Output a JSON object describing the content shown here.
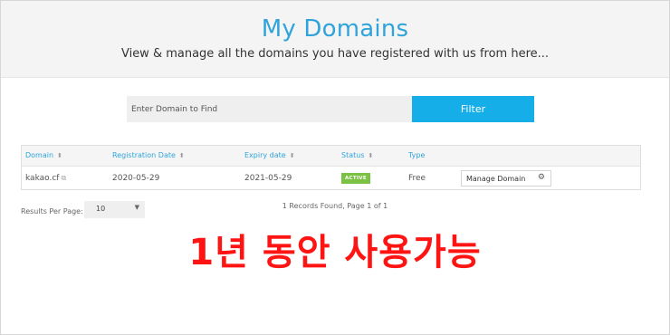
{
  "header": {
    "title": "My Domains",
    "subtitle": "View & manage all the domains you have registered with us from here..."
  },
  "search": {
    "placeholder": "Enter Domain to Find",
    "button_label": "Filter"
  },
  "table": {
    "columns": [
      "Domain",
      "Registration Date",
      "Expiry date",
      "Status",
      "Type"
    ],
    "rows": [
      {
        "domain": "kakao.cf",
        "registration_date": "2020-05-29",
        "expiry_date": "2021-05-29",
        "status": "ACTIVE",
        "type": "Free",
        "action_label": "Manage Domain"
      }
    ]
  },
  "pagination": {
    "results_per_page_label": "Results Per Page:",
    "results_per_page_value": "10",
    "records_text": "1 Records Found, Page 1 of 1"
  },
  "overlay_text": "1년 동안 사용가능",
  "colors": {
    "accent": "#2fa4db",
    "filter_button": "#16aee9",
    "status_active": "#7bc143",
    "overlay": "#ff1414"
  },
  "icons": [
    "sort-icon",
    "external-link-icon",
    "gear-icon",
    "caret-down-icon"
  ]
}
